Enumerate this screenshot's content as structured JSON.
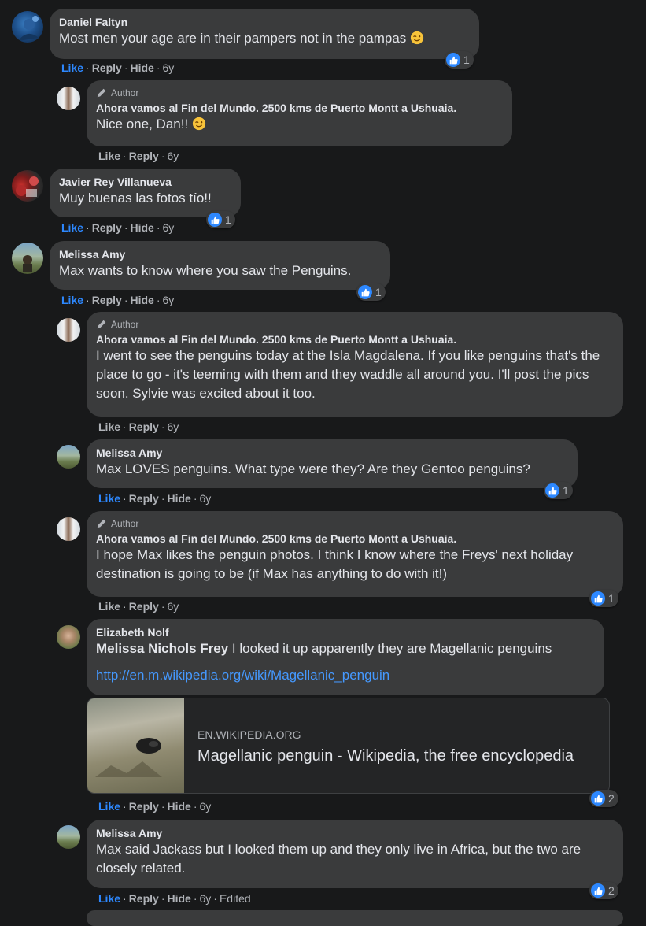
{
  "comments": [
    {
      "name": "Daniel Faltyn",
      "text": "Most men your age are in their pampers not in the pampas",
      "actions": {
        "like": "Like",
        "reply": "Reply",
        "hide": "Hide",
        "time": "6y"
      },
      "reactions": "1"
    },
    {
      "badge": "Author",
      "name": "Ahora vamos al Fin del Mundo. 2500 kms de Puerto Montt a Ushuaia.",
      "text": "Nice one, Dan!!",
      "actions": {
        "like": "Like",
        "reply": "Reply",
        "time": "6y"
      }
    },
    {
      "name": "Javier Rey Villanueva",
      "text": "Muy buenas las fotos tío!!",
      "actions": {
        "like": "Like",
        "reply": "Reply",
        "hide": "Hide",
        "time": "6y"
      },
      "reactions": "1"
    },
    {
      "name": "Melissa Amy",
      "text": "Max wants to know where you saw the Penguins.",
      "actions": {
        "like": "Like",
        "reply": "Reply",
        "hide": "Hide",
        "time": "6y"
      },
      "reactions": "1"
    },
    {
      "badge": "Author",
      "name": "Ahora vamos al Fin del Mundo. 2500 kms de Puerto Montt a Ushuaia.",
      "text": "I went to see the penguins today at the Isla Magdalena. If you like penguins that's the place to go - it's teeming with them and they waddle all around you. I'll post the pics soon. Sylvie was excited about it too.",
      "actions": {
        "like": "Like",
        "reply": "Reply",
        "time": "6y"
      }
    },
    {
      "name": "Melissa Amy",
      "text": "Max LOVES penguins. What type were they? Are they Gentoo penguins?",
      "actions": {
        "like": "Like",
        "reply": "Reply",
        "hide": "Hide",
        "time": "6y"
      },
      "reactions": "1"
    },
    {
      "badge": "Author",
      "name": "Ahora vamos al Fin del Mundo. 2500 kms de Puerto Montt a Ushuaia.",
      "text": "I hope Max likes the penguin photos. I think I know where the Freys' next holiday destination is going to be (if Max has anything to do with it!)",
      "actions": {
        "like": "Like",
        "reply": "Reply",
        "time": "6y"
      },
      "reactions": "1"
    },
    {
      "name": "Elizabeth Nolf",
      "mention": "Melissa Nichols Frey",
      "text": " I looked it up apparently they are Magellanic penguins",
      "link": "http://en.m.wikipedia.org/wiki/Magellanic_penguin",
      "preview": {
        "domain": "EN.WIKIPEDIA.ORG",
        "title": "Magellanic penguin - Wikipedia, the free encyclopedia"
      },
      "actions": {
        "like": "Like",
        "reply": "Reply",
        "hide": "Hide",
        "time": "6y"
      },
      "reactions": "2"
    },
    {
      "name": "Melissa Amy",
      "text": "Max said Jackass but I looked them up and they only live in Africa, but the two are closely related.",
      "actions": {
        "like": "Like",
        "reply": "Reply",
        "hide": "Hide",
        "time": "6y",
        "edited": "Edited"
      },
      "reactions": "2"
    }
  ],
  "colors": {
    "background": "#18191a",
    "bubble": "#3a3b3c",
    "link": "#4599ff",
    "like": "#2d88ff",
    "meta": "#b0b3b8"
  }
}
